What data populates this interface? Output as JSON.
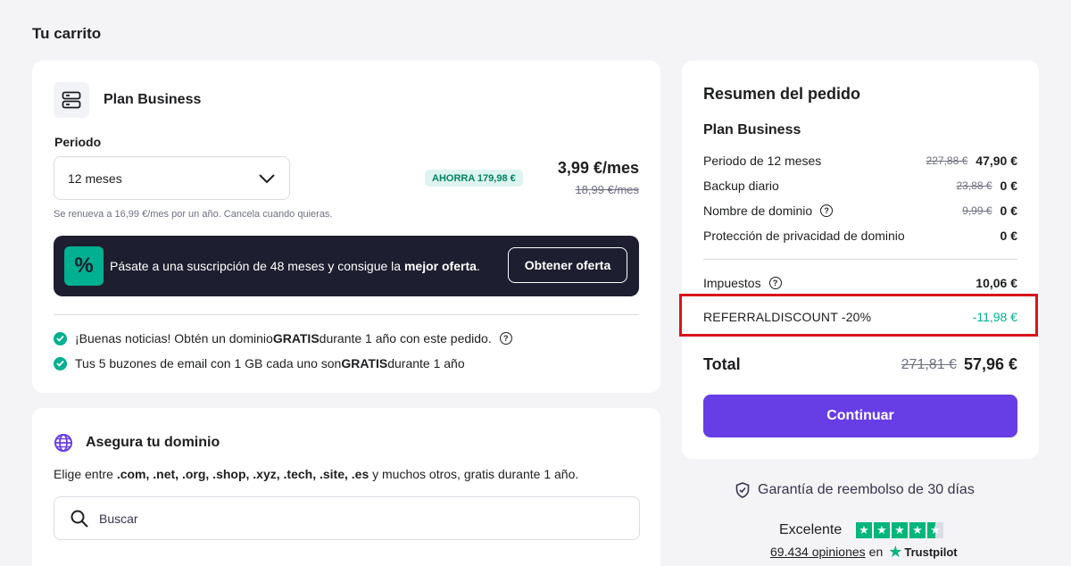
{
  "page": {
    "title": "Tu carrito"
  },
  "plan": {
    "name": "Plan Business",
    "period_label": "Periodo",
    "period_value": "12 meses",
    "save_badge": "AHORRA 179,98 €",
    "price": "3,99 €/mes",
    "old_price": "18,99 €/mes",
    "renew_note": "Se renueva a 16,99 €/mes por un año. Cancela cuando quieras."
  },
  "promo": {
    "icon": "%",
    "text_prefix": "Pásate a una suscripción de 48 meses y consigue la ",
    "text_bold": "mejor oferta",
    "text_suffix": ".",
    "button": "Obtener oferta"
  },
  "benefits": [
    {
      "prefix": "¡Buenas noticias! Obtén un dominio ",
      "bold": "GRATIS",
      "suffix": " durante 1 año con este pedido."
    },
    {
      "prefix": "Tus 5 buzones de email con 1 GB cada uno son ",
      "bold": "GRATIS",
      "suffix": " durante 1 año"
    }
  ],
  "domain": {
    "title": "Asegura tu dominio",
    "desc_prefix": "Elige entre ",
    "desc_bold": ".com, .net, .org, .shop, .xyz, .tech, .site, .es",
    "desc_suffix": " y muchos otros, gratis durante 1 año.",
    "search_placeholder": "Buscar"
  },
  "summary": {
    "title": "Resumen del pedido",
    "plan": "Plan Business",
    "rows": [
      {
        "label": "Periodo de 12 meses",
        "old": "227,88 €",
        "value": "47,90 €"
      },
      {
        "label": "Backup diario",
        "old": "23,88 €",
        "value": "0 €"
      },
      {
        "label": "Nombre de dominio",
        "old": "9,99 €",
        "value": "0 €"
      },
      {
        "label": "Protección de privacidad de dominio",
        "old": "",
        "value": "0 €"
      }
    ],
    "tax_label": "Impuestos",
    "tax_value": "10,06 €",
    "discount_label": "REFERRALDISCOUNT -20%",
    "discount_value": "-11,98 €",
    "total_label": "Total",
    "total_old": "271,81 €",
    "total_value": "57,96 €",
    "continue": "Continuar"
  },
  "trust": {
    "guarantee": "Garantía de reembolso de 30 días",
    "rating": "Excelente",
    "reviews": "69.434 opiniones",
    "reviews_on": "en",
    "brand": "Trustpilot"
  },
  "colors": {
    "accent": "#673de6",
    "success": "#00b090",
    "highlight": "#d9141b"
  }
}
